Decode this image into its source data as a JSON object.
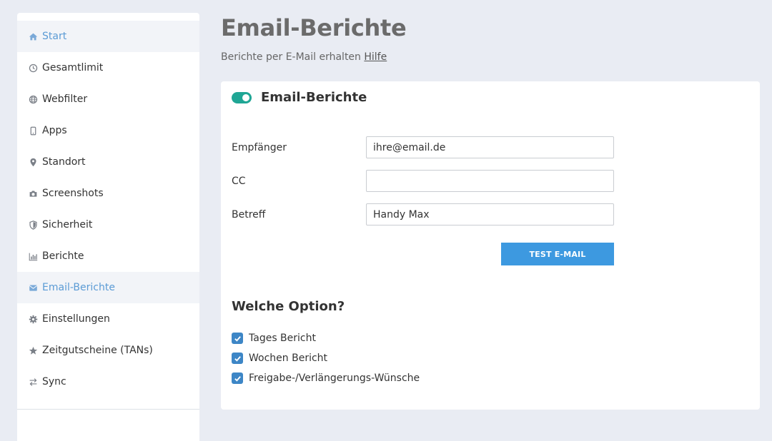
{
  "sidebar": {
    "items": [
      {
        "label": "Start",
        "icon": "home-icon",
        "active": true
      },
      {
        "label": "Gesamtlimit",
        "icon": "clock-icon",
        "active": false
      },
      {
        "label": "Webfilter",
        "icon": "globe-icon",
        "active": false
      },
      {
        "label": "Apps",
        "icon": "phone-icon",
        "active": false
      },
      {
        "label": "Standort",
        "icon": "map-pin-icon",
        "active": false
      },
      {
        "label": "Screenshots",
        "icon": "camera-icon",
        "active": false
      },
      {
        "label": "Sicherheit",
        "icon": "shield-icon",
        "active": false
      },
      {
        "label": "Berichte",
        "icon": "bar-chart-icon",
        "active": false
      },
      {
        "label": "Email-Berichte",
        "icon": "envelope-icon",
        "active": true
      },
      {
        "label": "Einstellungen",
        "icon": "gear-icon",
        "active": false
      },
      {
        "label": "Zeitgutscheine (TANs)",
        "icon": "star-icon",
        "active": false
      },
      {
        "label": "Sync",
        "icon": "sync-arrows-icon",
        "active": false
      }
    ]
  },
  "header": {
    "title": "Email-Berichte",
    "subtitle": "Berichte per E-Mail erhalten",
    "help_link": "Hilfe"
  },
  "card": {
    "title": "Email-Berichte",
    "toggle_on": true,
    "fields": {
      "recipient": {
        "label": "Empfänger",
        "value": "ihre@email.de"
      },
      "cc": {
        "label": "CC",
        "value": ""
      },
      "subject": {
        "label": "Betreff",
        "value": "Handy Max"
      }
    },
    "test_button": "TEST E-MAIL",
    "options_title": "Welche Option?",
    "options": [
      {
        "label": "Tages Bericht",
        "checked": true
      },
      {
        "label": "Wochen Bericht",
        "checked": true
      },
      {
        "label": "Freigabe-/Verlängerungs-Wünsche",
        "checked": true
      }
    ]
  },
  "colors": {
    "accent": "#3d99e0",
    "toggle": "#1fa695",
    "checkbox": "#3d86c6",
    "active_nav_text": "#5b9bd5"
  }
}
